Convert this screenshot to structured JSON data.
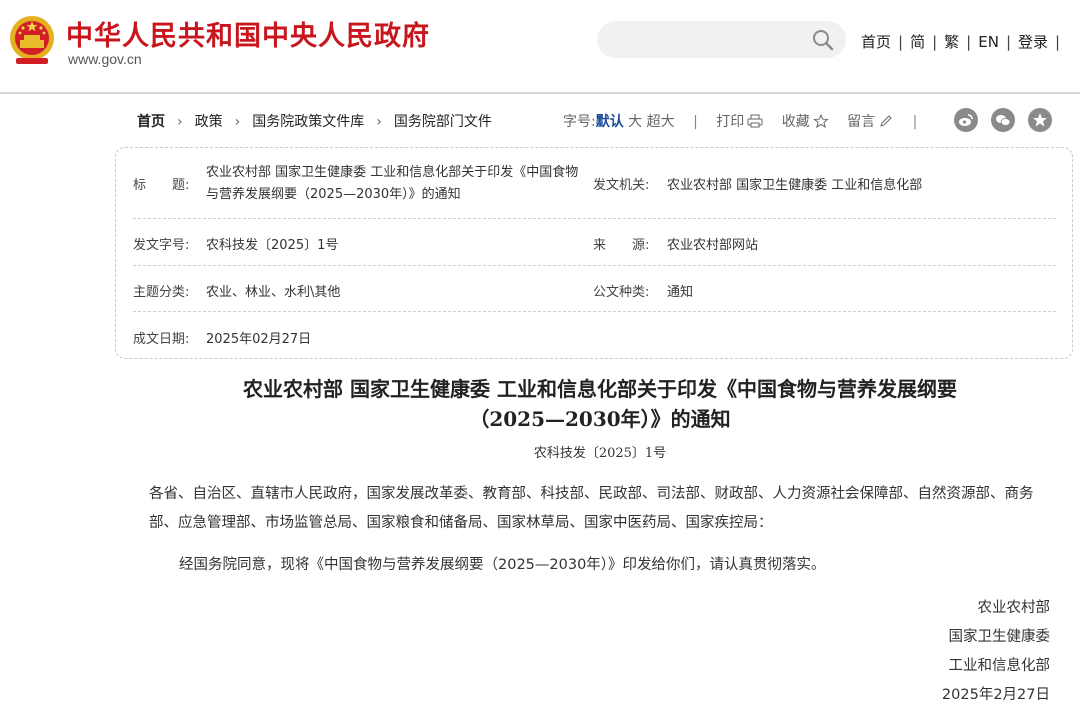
{
  "header": {
    "site_title": "中华人民共和国中央人民政府",
    "site_url": "www.gov.cn",
    "links": [
      "首页",
      "简",
      "繁",
      "EN",
      "登录"
    ],
    "link_separator": "|"
  },
  "breadcrumb": [
    "首页",
    "政策",
    "国务院政策文件库",
    "国务院部门文件"
  ],
  "tools": {
    "font_size_label": "字号:",
    "font_default": "默认",
    "font_large": "大",
    "font_xlarge": "超大",
    "separator": "|",
    "print": "打印",
    "favorite": "收藏",
    "comment": "留言"
  },
  "info": {
    "title_label": "标　　题:",
    "title_value": "农业农村部 国家卫生健康委 工业和信息化部关于印发《中国食物与营养发展纲要（2025—2030年）》的通知",
    "issuer_label": "发文机关:",
    "issuer_value": "农业农村部 国家卫生健康委 工业和信息化部",
    "doc_no_label": "发文字号:",
    "doc_no_value": "农科技发〔2025〕1号",
    "source_label": "来　　源:",
    "source_value": "农业农村部网站",
    "category_label": "主题分类:",
    "category_value": "农业、林业、水利\\其他",
    "type_label": "公文种类:",
    "type_value": "通知",
    "date_label": "成文日期:",
    "date_value": "2025年02月27日"
  },
  "article": {
    "title_line1": "农业农村部 国家卫生健康委 工业和信息化部关于印发《中国食物与营养发展纲要",
    "title_line2": "（2025—2030年）》的通知",
    "doc_number": "农科技发〔2025〕1号",
    "recipients": "各省、自治区、直辖市人民政府，国家发展改革委、教育部、科技部、民政部、司法部、财政部、人力资源社会保障部、自然资源部、商务部、应急管理部、市场监管总局、国家粮食和储备局、国家林草局、国家中医药局、国家疾控局：",
    "body": "经国务院同意，现将《中国食物与营养发展纲要（2025—2030年）》印发给你们，请认真贯彻落实。",
    "signatures": [
      "农业农村部",
      "国家卫生健康委",
      "工业和信息化部",
      "2025年2月27日"
    ]
  },
  "colors": {
    "brand_red": "#c8161e",
    "accent_blue": "#1a4b9a",
    "share_gray": "#8a8a8a"
  },
  "icons": [
    "national-emblem",
    "search-icon",
    "print-icon",
    "star-icon",
    "pencil-icon",
    "weibo-icon",
    "wechat-icon",
    "qzone-icon"
  ]
}
